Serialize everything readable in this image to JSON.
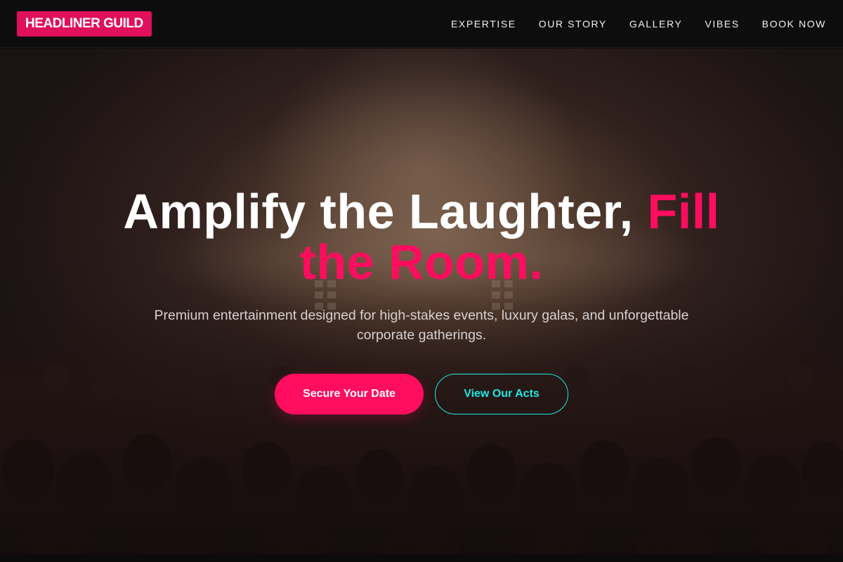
{
  "brand": {
    "logo_text": "HEADLINER GUILD"
  },
  "nav": {
    "items": [
      {
        "label": "EXPERTISE"
      },
      {
        "label": "OUR STORY"
      },
      {
        "label": "GALLERY"
      },
      {
        "label": "VIBES"
      },
      {
        "label": "BOOK NOW"
      }
    ]
  },
  "hero": {
    "headline_main": "Amplify the Laughter, ",
    "headline_accent": "Fill the Room.",
    "subtitle": "Premium entertainment designed for high-stakes events, luxury galas, and unforgettable corporate gatherings.",
    "primary_cta": "Secure Your Date",
    "secondary_cta": "View Our Acts"
  },
  "colors": {
    "brand_accent": "#ff0d5e",
    "secondary_accent": "#20e8e0",
    "nav_background": "#0d0d0d"
  }
}
